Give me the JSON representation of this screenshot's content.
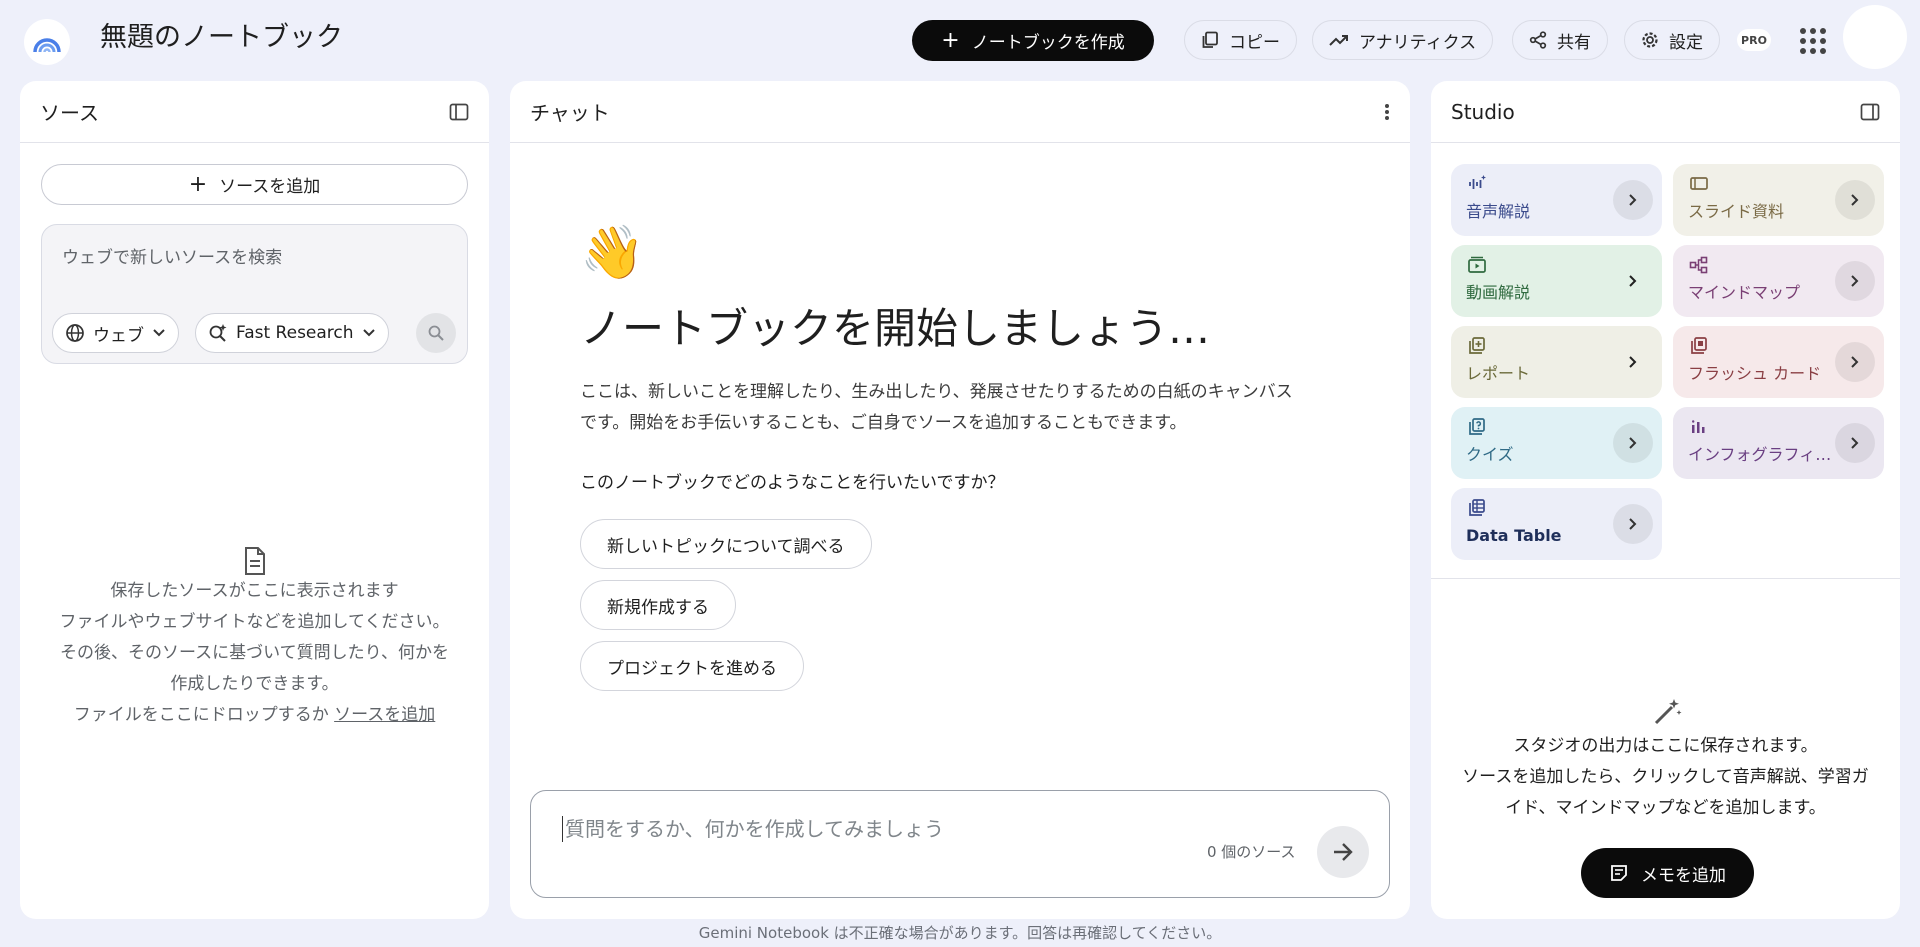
{
  "header": {
    "title": "無題のノートブック",
    "create_label": "ノートブックを作成",
    "copy_label": "コピー",
    "analytics_label": "アナリティクス",
    "share_label": "共有",
    "settings_label": "設定",
    "pro_badge": "PRO"
  },
  "sources": {
    "title": "ソース",
    "add_label": "ソースを追加",
    "search_placeholder": "ウェブで新しいソースを検索",
    "web_chip": "ウェブ",
    "research_chip": "Fast Research",
    "empty_line1": "保存したソースがここに表示されます",
    "empty_line2": "ファイルやウェブサイトなどを追加してください。",
    "empty_line3": "その後、そのソースに基づいて質問したり、何かを",
    "empty_line4": "作成したりできます。",
    "empty_line5_prefix": "ファイルをここにドロップするか ",
    "empty_link": "ソースを追加"
  },
  "chat": {
    "title": "チャット",
    "wave_emoji": "👋",
    "heading": "ノートブックを開始しましょう…",
    "desc_line1": "ここは、新しいことを理解したり、生み出したり、発展させたりするための白紙のキャンバス",
    "desc_line2": "です。開始をお手伝いすることも、ご自身でソースを追加することもできます。",
    "question": "このノートブックでどのようなことを行いたいですか？",
    "suggestions": [
      "新しいトピックについて調べる",
      "新規作成する",
      "プロジェクトを進める"
    ],
    "input_placeholder": "質問をするか、何かを作成してみましょう",
    "source_count": "0 個のソース"
  },
  "studio": {
    "title": "Studio",
    "tiles": [
      {
        "label": "音声解説",
        "icon": "audio-waveform-icon"
      },
      {
        "label": "スライド資料",
        "icon": "slides-icon"
      },
      {
        "label": "動画解説",
        "icon": "video-icon"
      },
      {
        "label": "マインドマップ",
        "icon": "mind-map-icon"
      },
      {
        "label": "レポート",
        "icon": "report-icon"
      },
      {
        "label": "フラッシュ カード",
        "icon": "flashcard-icon"
      },
      {
        "label": "クイズ",
        "icon": "quiz-icon"
      },
      {
        "label": "インフォグラフィ…",
        "icon": "infographic-icon"
      },
      {
        "label": "Data Table",
        "icon": "table-icon"
      }
    ],
    "empty_line1": "スタジオの出力はここに保存されます。",
    "empty_line2": "ソースを追加したら、クリックして音声解説、学習ガ",
    "empty_line3": "イド、マインドマップなどを追加します。",
    "memo_label": "メモを追加"
  },
  "footer": {
    "disclaimer": "Gemini Notebook は不正確な場合があります。回答は再確認してください。"
  }
}
